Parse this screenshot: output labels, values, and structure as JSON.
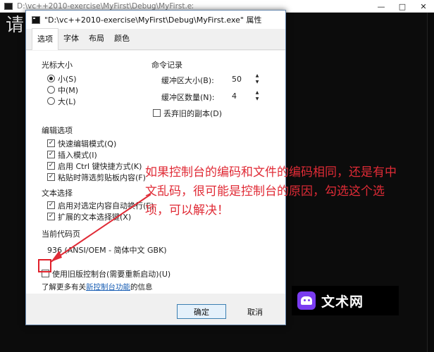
{
  "console": {
    "title": "D:\\vc++2010-exercise\\MyFirst\\Debug\\MyFirst.exe",
    "text": "请",
    "controls": [
      "—",
      "□",
      "✕"
    ]
  },
  "dialog": {
    "title": "\"D:\\vc++2010-exercise\\MyFirst\\Debug\\MyFirst.exe\" 属性",
    "tabs": [
      {
        "label": "选项",
        "active": true
      },
      {
        "label": "字体",
        "active": false
      },
      {
        "label": "布局",
        "active": false
      },
      {
        "label": "颜色",
        "active": false
      }
    ],
    "cursor_size": {
      "label": "光标大小",
      "options": [
        {
          "label": "小(S)",
          "selected": true
        },
        {
          "label": "中(M)",
          "selected": false
        },
        {
          "label": "大(L)",
          "selected": false
        }
      ]
    },
    "command_history": {
      "label": "命令记录",
      "buffer_size_label": "缓冲区大小(B):",
      "buffer_size_value": "50",
      "buffer_count_label": "缓冲区数量(N):",
      "buffer_count_value": "4",
      "discard_old_label": "丢弃旧的副本(D)",
      "discard_old_checked": false
    },
    "edit_options": {
      "label": "编辑选项",
      "items": [
        {
          "label": "快速编辑模式(Q)",
          "checked": true
        },
        {
          "label": "插入模式(I)",
          "checked": true
        },
        {
          "label": "启用 Ctrl 键快捷方式(K)",
          "checked": true
        },
        {
          "label": "粘贴时筛选剪贴板内容(F)",
          "checked": true
        }
      ]
    },
    "text_selection": {
      "label": "文本选择",
      "items": [
        {
          "label": "启用对选定内容自动换行(E)",
          "checked": true
        },
        {
          "label": "扩展的文本选择键(X)",
          "checked": true
        }
      ]
    },
    "codepage": {
      "label": "当前代码页",
      "value": "936   (ANSI/OEM - 简体中文 GBK)"
    },
    "legacy_console": {
      "label": "使用旧版控制台(需要重新启动)(U)",
      "checked": false
    },
    "learn_more": {
      "prefix": "了解更多有关",
      "link": "新控制台功能",
      "suffix": "的信息"
    },
    "buttons": {
      "ok": "确定",
      "cancel": "取消"
    }
  },
  "annotation": {
    "text": "如果控制台的编码和文件的编码相同，还是有中文乱码，很可能是控制台的原因，勾选这个选项，可以解决！",
    "color": "#e02b36"
  },
  "watermark": {
    "text": "文术网"
  }
}
